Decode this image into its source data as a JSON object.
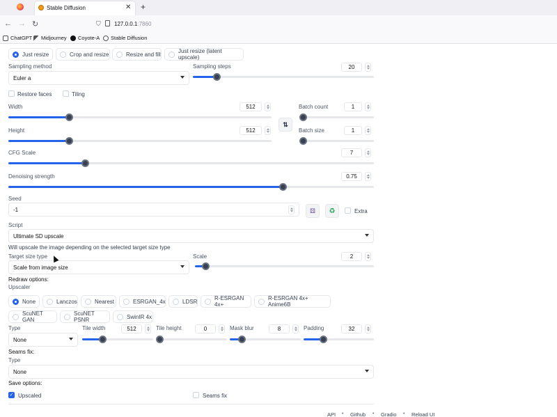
{
  "browser": {
    "tab_title": "Stable Diffusion",
    "url_host": "127.0.0.1",
    "url_port": ":7860",
    "bookmarks": [
      "ChatGPT",
      "Midjourney",
      "Coyote-A",
      "Stable Diffusion"
    ]
  },
  "resize_modes": {
    "selected": "Just resize",
    "options": [
      "Just resize",
      "Crop and resize",
      "Resize and fill",
      "Just resize (latent upscale)"
    ]
  },
  "sampling": {
    "method_label": "Sampling method",
    "method_value": "Euler a",
    "steps_label": "Sampling steps",
    "steps_value": "20",
    "steps_fraction": 0.13
  },
  "checks": {
    "restore_faces": "Restore faces",
    "tiling": "Tiling"
  },
  "width": {
    "label": "Width",
    "value": "512",
    "fraction": 0.23
  },
  "height": {
    "label": "Height",
    "value": "512",
    "fraction": 0.23
  },
  "batch_count": {
    "label": "Batch count",
    "value": "1",
    "fraction": 0.0
  },
  "batch_size": {
    "label": "Batch size",
    "value": "1",
    "fraction": 0.0
  },
  "cfg": {
    "label": "CFG Scale",
    "value": "7",
    "fraction": 0.21
  },
  "denoise": {
    "label": "Denoising strength",
    "value": "0.75",
    "fraction": 0.75
  },
  "seed": {
    "label": "Seed",
    "value": "-1",
    "extra_label": "Extra"
  },
  "script": {
    "label": "Script",
    "value": "Ultimate SD upscale",
    "info": "Will upscale the image depending on the selected target size type"
  },
  "target_size": {
    "label": "Target size type",
    "value": "Scale from image size"
  },
  "scale": {
    "label": "Scale",
    "value": "2",
    "fraction": 0.06
  },
  "redraw": {
    "heading": "Redraw options:",
    "upscaler_label": "Upscaler",
    "upscaler_selected": "None",
    "upscalers_row1": [
      "None",
      "Lanczos",
      "Nearest",
      "ESRGAN_4x",
      "LDSR",
      "R-ESRGAN 4x+",
      "R-ESRGAN 4x+ Anime6B"
    ],
    "upscalers_row2": [
      "ScuNET GAN",
      "ScuNET PSNR",
      "SwinIR 4x"
    ],
    "type_label": "Type",
    "type_value": "None",
    "tile_width": {
      "label": "Tile width",
      "value": "512",
      "fraction": 0.28
    },
    "tile_height": {
      "label": "Tile height",
      "value": "0",
      "fraction": 0.0
    },
    "mask_blur": {
      "label": "Mask blur",
      "value": "8",
      "fraction": 0.17
    },
    "padding": {
      "label": "Padding",
      "value": "32",
      "fraction": 0.28
    }
  },
  "seams": {
    "heading": "Seams fix:",
    "type_label": "Type",
    "type_value": "None"
  },
  "save": {
    "heading": "Save options:",
    "upscaled": "Upscaled",
    "seams_fix": "Seams fix"
  },
  "footer": [
    "API",
    "Github",
    "Gradio",
    "Reload UI"
  ],
  "colors": {
    "accent": "#2563eb",
    "thumb": "#374151"
  }
}
